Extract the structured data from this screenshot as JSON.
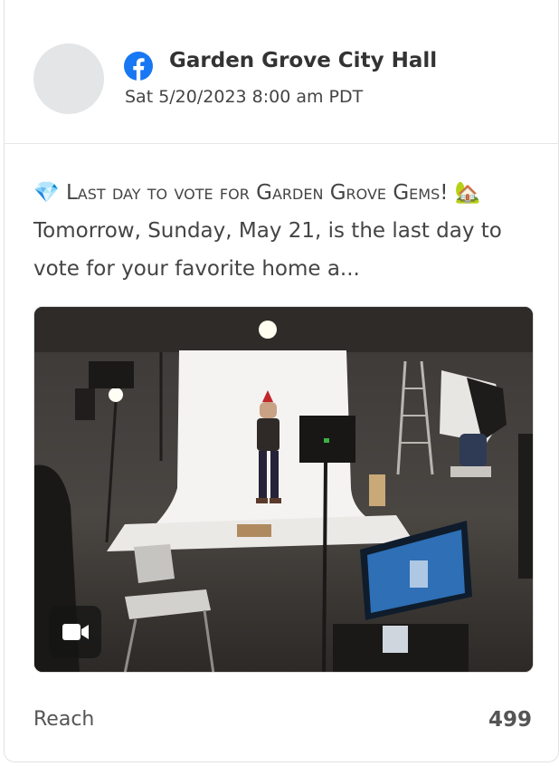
{
  "post": {
    "page_name": "Garden Grove City Hall",
    "timestamp": "Sat 5/20/2023 8:00 am PDT",
    "text_emoji_1": "💎",
    "text_caps": "Last day to vote for Garden Grove Gems!",
    "text_emoji_2": "🏡",
    "text_rest": " Tomorrow, Sunday, May 21, is the last day to vote for your favorite home a...",
    "media_type": "video",
    "icons": {
      "platform": "facebook-icon",
      "media": "video-camera-icon"
    }
  },
  "stats": {
    "reach_label": "Reach",
    "reach_value": "499"
  },
  "colors": {
    "accent_bar": "#3b7be5",
    "facebook_blue": "#1877f2"
  }
}
